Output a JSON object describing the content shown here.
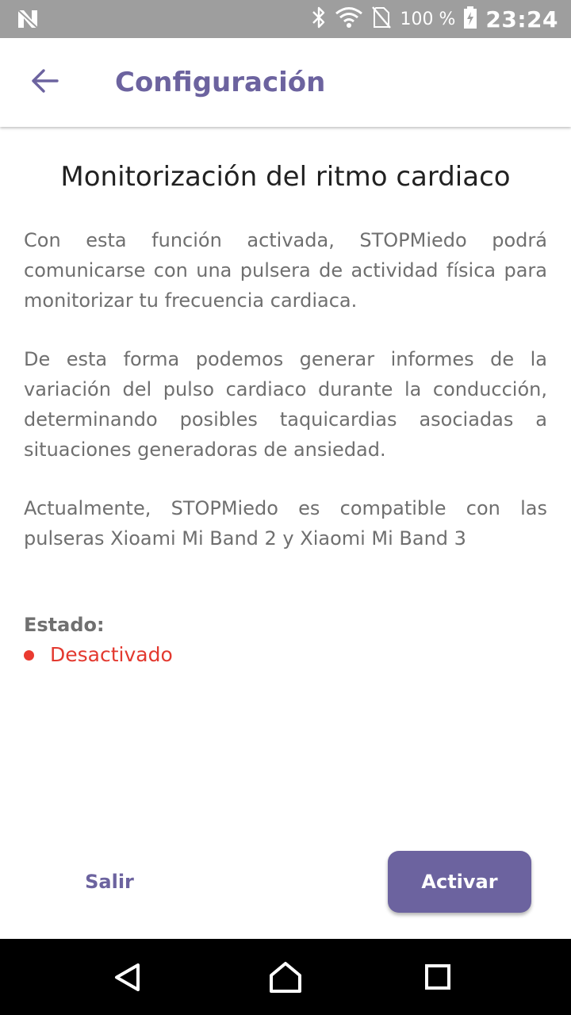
{
  "status_bar": {
    "battery_text": "100 %",
    "time": "23:24",
    "icons": [
      "notification-n-icon",
      "bluetooth-icon",
      "wifi-icon",
      "no-sim-icon",
      "battery-charging-icon"
    ]
  },
  "app_bar": {
    "back_icon": "arrow-left-icon",
    "title": "Configuración"
  },
  "content": {
    "heading": "Monitorización del ritmo cardiaco",
    "paragraphs": [
      "Con esta función activada, STOPMiedo podrá comunicarse con una pulsera de actividad física para monitorizar tu frecuencia cardiaca.",
      "De esta forma podemos generar informes de la variación del pulso cardiaco durante la conducción, determinando posibles taquicardias asociadas a situaciones generadoras de ansiedad.",
      "Actualmente, STOPMiedo es compatible con las pulseras Xioami Mi Band 2 y Xiaomi Mi Band 3"
    ],
    "status_label": "Estado:",
    "status_value": "Desactivado"
  },
  "actions": {
    "exit_label": "Salir",
    "activate_label": "Activar"
  },
  "nav_bar": {
    "icons": [
      "back-triangle-icon",
      "home-icon",
      "recents-square-icon"
    ]
  },
  "colors": {
    "accent": "#6c639f",
    "status_off": "#e3392f",
    "status_bar_bg": "#9e9e9e",
    "body_text": "#6f6f6f"
  }
}
